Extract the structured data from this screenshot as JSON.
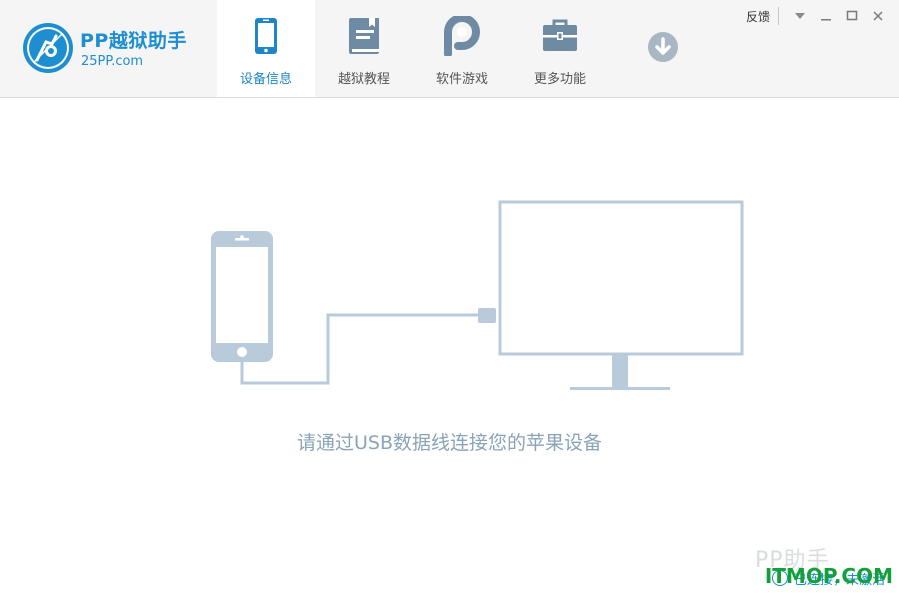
{
  "app": {
    "brand_name": "PP越狱助手",
    "brand_url": "25PP.com",
    "accent_color": "#1d8ed0"
  },
  "nav": {
    "tabs": [
      {
        "label": "设备信息",
        "icon": "phone-icon",
        "active": true
      },
      {
        "label": "越狱教程",
        "icon": "book-icon",
        "active": false
      },
      {
        "label": "软件游戏",
        "icon": "pp-logo-icon",
        "active": false
      },
      {
        "label": "更多功能",
        "icon": "toolbox-icon",
        "active": false
      },
      {
        "label": "",
        "icon": "download-icon",
        "active": false
      }
    ]
  },
  "window": {
    "feedback_label": "反馈",
    "menu_icon": "dropdown-triangle-icon",
    "minimize_icon": "minimize-icon",
    "maximize_icon": "maximize-icon",
    "close_icon": "close-icon"
  },
  "main": {
    "hint": "请通过USB数据线连接您的苹果设备",
    "illustration": "iphone-usb-monitor-illustration",
    "illustration_color": "#b9cada"
  },
  "status": {
    "icon": "info-icon",
    "text": "已连接，未激活"
  },
  "watermark": {
    "text": "PP助手",
    "site": "ITMOP.COM"
  }
}
